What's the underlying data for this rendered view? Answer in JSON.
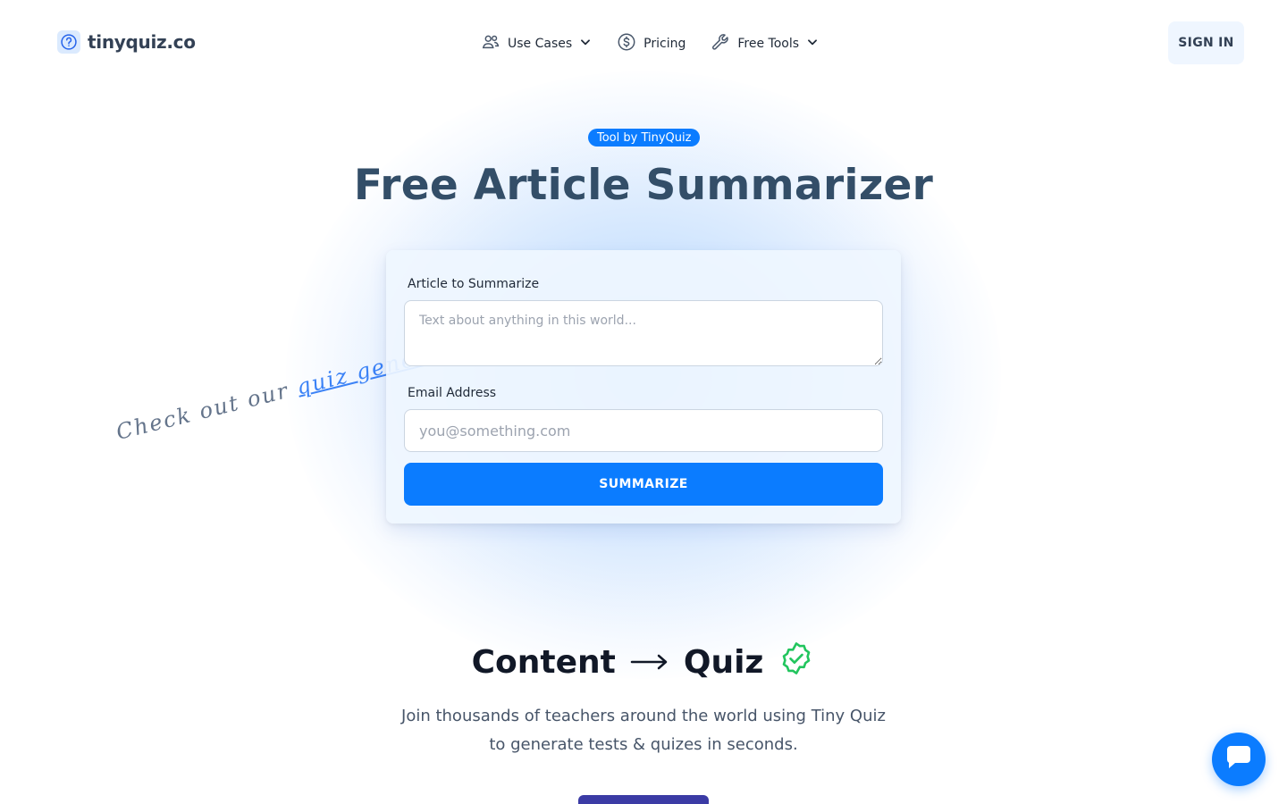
{
  "header": {
    "logo_text": "tinyquiz.co",
    "nav": [
      {
        "label": "Use Cases",
        "icon": "users-icon",
        "dropdown": true
      },
      {
        "label": "Pricing",
        "icon": "dollar-circle-icon",
        "dropdown": false
      },
      {
        "label": "Free Tools",
        "icon": "wrench-icon",
        "dropdown": true
      }
    ],
    "signin_label": "SIGN IN"
  },
  "hero": {
    "badge": "Tool by TinyQuiz",
    "title": "Free Article Summarizer"
  },
  "form": {
    "article_label": "Article to Summarize",
    "article_placeholder": "Text about anything in this world...",
    "email_label": "Email Address",
    "email_placeholder": "you@something.com",
    "submit_label": "SUMMARIZE"
  },
  "promo": {
    "prefix": "Check out our ",
    "link": "quiz generator"
  },
  "section": {
    "left": "Content",
    "right": "Quiz",
    "subtitle": "Join thousands of teachers around the world using Tiny Quiz to generate tests & quizes in seconds."
  },
  "colors": {
    "accent": "#0b7cff",
    "title": "#334e68",
    "check": "#22c55e"
  }
}
